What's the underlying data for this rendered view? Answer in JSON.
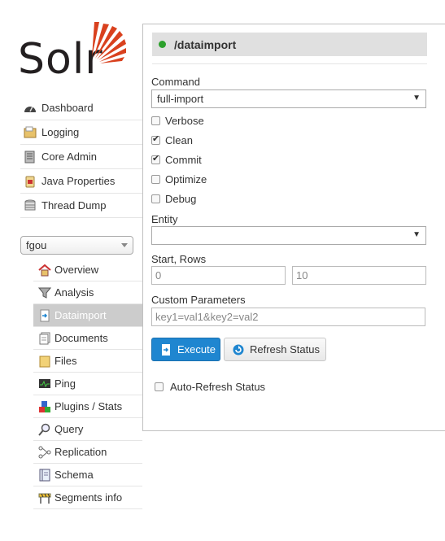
{
  "logo": {
    "text": "Solr"
  },
  "nav": [
    {
      "label": "Dashboard",
      "icon": "dashboard-icon"
    },
    {
      "label": "Logging",
      "icon": "logging-icon"
    },
    {
      "label": "Core Admin",
      "icon": "core-admin-icon"
    },
    {
      "label": "Java Properties",
      "icon": "java-properties-icon"
    },
    {
      "label": "Thread Dump",
      "icon": "thread-dump-icon"
    }
  ],
  "core_selector": {
    "value": "fgou"
  },
  "core_menu": [
    {
      "label": "Overview",
      "icon": "home-icon"
    },
    {
      "label": "Analysis",
      "icon": "funnel-icon"
    },
    {
      "label": "Dataimport",
      "icon": "dataimport-icon",
      "active": true
    },
    {
      "label": "Documents",
      "icon": "documents-icon"
    },
    {
      "label": "Files",
      "icon": "folder-icon"
    },
    {
      "label": "Ping",
      "icon": "ping-icon"
    },
    {
      "label": "Plugins / Stats",
      "icon": "plugins-icon"
    },
    {
      "label": "Query",
      "icon": "magnifier-icon"
    },
    {
      "label": "Replication",
      "icon": "replication-icon"
    },
    {
      "label": "Schema",
      "icon": "schema-icon"
    },
    {
      "label": "Segments info",
      "icon": "segments-icon"
    }
  ],
  "panel": {
    "title": "/dataimport",
    "command_label": "Command",
    "command_value": "full-import",
    "checkboxes": [
      {
        "label": "Verbose",
        "checked": false
      },
      {
        "label": "Clean",
        "checked": true
      },
      {
        "label": "Commit",
        "checked": true
      },
      {
        "label": "Optimize",
        "checked": false
      },
      {
        "label": "Debug",
        "checked": false
      }
    ],
    "entity_label": "Entity",
    "entity_value": "",
    "start_rows_label": "Start, Rows",
    "start_value": "0",
    "rows_value": "10",
    "custom_params_label": "Custom Parameters",
    "custom_params_placeholder": "key1=val1&key2=val2",
    "execute_label": "Execute",
    "refresh_label": "Refresh Status",
    "auto_refresh_label": "Auto-Refresh Status"
  },
  "colors": {
    "accent": "#1f86d0",
    "status_ok": "#2ca02c",
    "logo_red": "#d9411e"
  }
}
